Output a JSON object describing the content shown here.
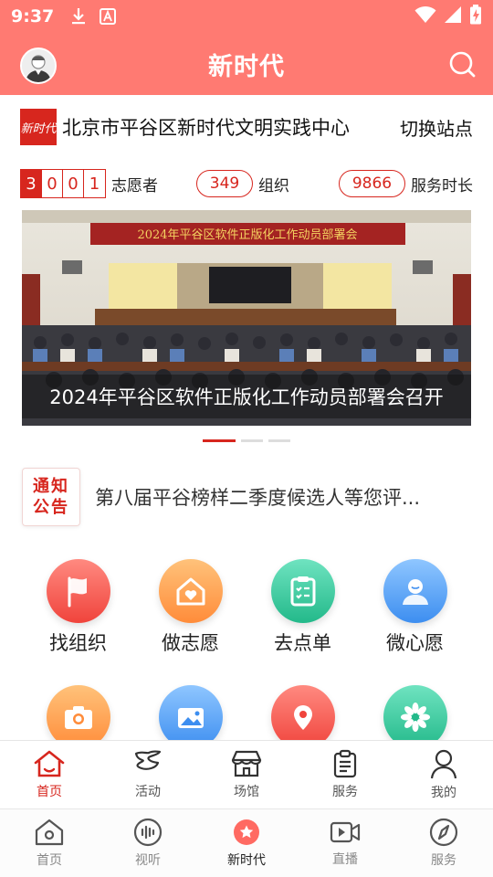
{
  "status_bar": {
    "time": "9:37",
    "icons": [
      "download-icon",
      "font-a-icon",
      "wifi-icon",
      "signal-icon",
      "battery-charging-icon"
    ]
  },
  "header": {
    "title": "新时代",
    "avatar_icon": "user-avatar-icon",
    "search_icon": "search-icon"
  },
  "site": {
    "logo_text": "新时代",
    "name": "北京市平谷区新时代文明实践中心",
    "switch_label": "切换站点"
  },
  "stats": {
    "volunteer_digits": [
      "3",
      "0",
      "0",
      "1"
    ],
    "volunteer_label": "志愿者",
    "org_count": "349",
    "org_label": "组织",
    "service_hours": "9866",
    "service_label": "服务时长"
  },
  "banner": {
    "stage_text": "2024年平谷区软件正版化工作动员部署会",
    "caption": "2024年平谷区软件正版化工作动员部署会召开",
    "slides_total": 3,
    "active_slide": 1
  },
  "notice": {
    "tag_line1": "通知",
    "tag_line2": "公告",
    "text": "第八届平谷榜样二季度候选人等您评..."
  },
  "grid": {
    "items": [
      {
        "label": "找组织",
        "icon": "flag-icon",
        "color_from": "#ff8a80",
        "color_to": "#f0443c"
      },
      {
        "label": "做志愿",
        "icon": "heart-house-icon",
        "color_from": "#ffc27a",
        "color_to": "#ff8c3a"
      },
      {
        "label": "去点单",
        "icon": "clipboard-list-icon",
        "color_from": "#6fe3c0",
        "color_to": "#23b98a"
      },
      {
        "label": "微心愿",
        "icon": "person-wish-icon",
        "color_from": "#8fc6ff",
        "color_to": "#3d8ef0"
      },
      {
        "label": "",
        "icon": "camera-icon",
        "color_from": "#ffc27a",
        "color_to": "#ff8c3a"
      },
      {
        "label": "",
        "icon": "image-gallery-icon",
        "color_from": "#8fc6ff",
        "color_to": "#3d8ef0"
      },
      {
        "label": "",
        "icon": "map-pin-icon",
        "color_from": "#ff8a80",
        "color_to": "#f0443c"
      },
      {
        "label": "",
        "icon": "flower-icon",
        "color_from": "#6fe3c0",
        "color_to": "#23b98a"
      }
    ]
  },
  "tabbar_top": {
    "items": [
      {
        "label": "首页",
        "icon": "home-icon",
        "active": true
      },
      {
        "label": "活动",
        "icon": "activity-icon",
        "active": false
      },
      {
        "label": "场馆",
        "icon": "venue-icon",
        "active": false
      },
      {
        "label": "服务",
        "icon": "service-clipboard-icon",
        "active": false
      },
      {
        "label": "我的",
        "icon": "user-icon",
        "active": false
      }
    ]
  },
  "tabbar_bottom": {
    "items": [
      {
        "label": "首页",
        "icon": "home-outline-icon",
        "active": false
      },
      {
        "label": "视听",
        "icon": "audio-wave-icon",
        "active": false
      },
      {
        "label": "新时代",
        "icon": "star-circle-icon",
        "active": true
      },
      {
        "label": "直播",
        "icon": "video-live-icon",
        "active": false
      },
      {
        "label": "服务",
        "icon": "compass-icon",
        "active": false
      }
    ]
  },
  "colors": {
    "header_bg": "#ff7a72",
    "accent_red": "#d7261e"
  }
}
